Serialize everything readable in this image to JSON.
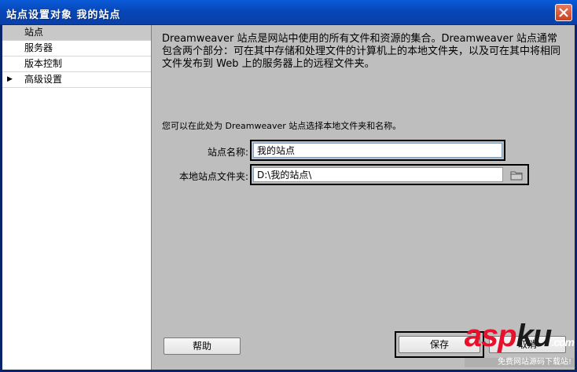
{
  "window": {
    "title": "站点设置对象 我的站点"
  },
  "sidebar": {
    "items": [
      {
        "label": "站点",
        "selected": true,
        "expander": ""
      },
      {
        "label": "服务器",
        "selected": false,
        "expander": ""
      },
      {
        "label": "版本控制",
        "selected": false,
        "expander": ""
      },
      {
        "label": "高级设置",
        "selected": false,
        "expander": "▶"
      }
    ]
  },
  "main": {
    "description": "Dreamweaver 站点是网站中使用的所有文件和资源的集合。Dreamweaver 站点通常包含两个部分：可在其中存储和处理文件的计算机上的本地文件夹，以及可在其中将相同文件发布到 Web 上的服务器上的远程文件夹。",
    "local_note": "您可以在此处为 Dreamweaver 站点选择本地文件夹和名称。",
    "site_name_label": "站点名称:",
    "site_name_value": "我的站点",
    "local_folder_label": "本地站点文件夹:",
    "local_folder_value": "D:\\我的站点\\"
  },
  "buttons": {
    "help": "帮助",
    "save": "保存",
    "cancel": "取消"
  },
  "watermark": {
    "brand_part1": "asp",
    "brand_part2": "ku",
    "suffix": ".com",
    "tagline": "免费网站源码下载站!"
  },
  "icons": {
    "close": "close-icon",
    "folder": "folder-icon",
    "expander": "triangle-right-icon"
  }
}
